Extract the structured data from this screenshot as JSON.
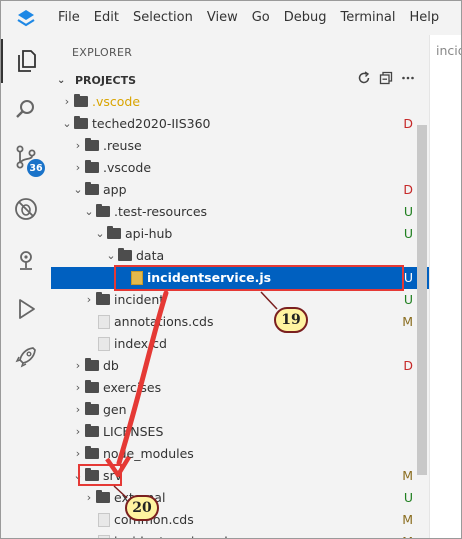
{
  "menu": [
    "File",
    "Edit",
    "Selection",
    "View",
    "Go",
    "Debug",
    "Terminal",
    "Help"
  ],
  "sidebar": {
    "title": "EXPLORER",
    "section": "PROJECTS",
    "actions": [
      "refresh-icon",
      "collapse-all-icon",
      "more-icon"
    ]
  },
  "scm_badge": "36",
  "editor_tab": "incid",
  "tree": [
    {
      "label": ".vscode",
      "depth": 0,
      "type": "folder",
      "expanded": false,
      "status": "",
      "color": "orange"
    },
    {
      "label": "teched2020-IIS360",
      "depth": 0,
      "type": "folder",
      "expanded": true,
      "status": "D"
    },
    {
      "label": ".reuse",
      "depth": 1,
      "type": "folder",
      "expanded": false,
      "status": ""
    },
    {
      "label": ".vscode",
      "depth": 1,
      "type": "folder",
      "expanded": false,
      "status": ""
    },
    {
      "label": "app",
      "depth": 1,
      "type": "folder",
      "expanded": true,
      "status": "D"
    },
    {
      "label": ".test-resources",
      "depth": 2,
      "type": "folder",
      "expanded": true,
      "status": "U"
    },
    {
      "label": "api-hub",
      "depth": 3,
      "type": "folder",
      "expanded": true,
      "status": "U"
    },
    {
      "label": "data",
      "depth": 4,
      "type": "folder",
      "expanded": true,
      "status": ""
    },
    {
      "label": "incidentservice.js",
      "depth": 5,
      "type": "js",
      "status": "U",
      "selected": true
    },
    {
      "label": "incident",
      "depth": 2,
      "type": "folder",
      "expanded": false,
      "status": "U"
    },
    {
      "label": "annotations.cds",
      "depth": 2,
      "type": "file",
      "status": "M"
    },
    {
      "label": "index.cd",
      "depth": 2,
      "type": "file",
      "status": ""
    },
    {
      "label": "db",
      "depth": 1,
      "type": "folder",
      "expanded": false,
      "status": "D"
    },
    {
      "label": "exercises",
      "depth": 1,
      "type": "folder",
      "expanded": false,
      "status": ""
    },
    {
      "label": "gen",
      "depth": 1,
      "type": "folder",
      "expanded": false,
      "status": ""
    },
    {
      "label": "LICENSES",
      "depth": 1,
      "type": "folder",
      "expanded": false,
      "status": ""
    },
    {
      "label": "node_modules",
      "depth": 1,
      "type": "folder",
      "expanded": false,
      "status": ""
    },
    {
      "label": "srv",
      "depth": 1,
      "type": "folder",
      "expanded": true,
      "status": "M"
    },
    {
      "label": "external",
      "depth": 2,
      "type": "folder",
      "expanded": false,
      "status": "U"
    },
    {
      "label": "common.cds",
      "depth": 2,
      "type": "file",
      "status": "M"
    },
    {
      "label": "incidentservice.cds",
      "depth": 2,
      "type": "file",
      "status": "M"
    }
  ],
  "callouts": {
    "first": "19",
    "second": "20"
  },
  "colors": {
    "selection": "#0060c0",
    "annotation_red": "#e53935",
    "callout_fill": "#fff3a0",
    "badge": "#1a73c9"
  }
}
